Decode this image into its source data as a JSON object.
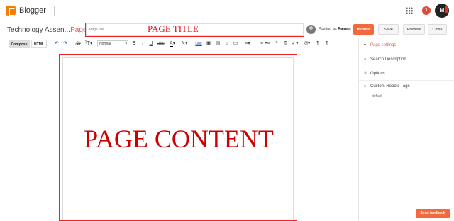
{
  "app": {
    "brand": "Blogger",
    "notification_count": "1",
    "profile_initial": "M"
  },
  "header": {
    "blog_name": "Technology Assen...",
    "separator": "·",
    "page_label": "Page",
    "title_placeholder": "Page title",
    "title_annotation": "PAGE TITLE",
    "posting_prefix": "Posting as",
    "posting_user": "Raman",
    "publish_label": "Publish",
    "save_label": "Save",
    "preview_label": "Preview",
    "close_label": "Close"
  },
  "toolbar": {
    "compose_label": "Compose",
    "html_label": "HTML",
    "font_value": "Normal",
    "link_label": "Link"
  },
  "editor": {
    "content_annotation": "PAGE CONTENT"
  },
  "sidebar": {
    "heading": "Page settings",
    "items": [
      {
        "label": "Search Description",
        "icon": "search-icon"
      },
      {
        "label": "Options",
        "icon": "gear-icon"
      },
      {
        "label": "Custom Robots Tags",
        "icon": "search-icon"
      }
    ],
    "robots_value": "default",
    "feedback_label": "Send feedback"
  },
  "colors": {
    "accent": "#f4683d",
    "annotation": "#dd1111",
    "brand": "#f57d00"
  }
}
